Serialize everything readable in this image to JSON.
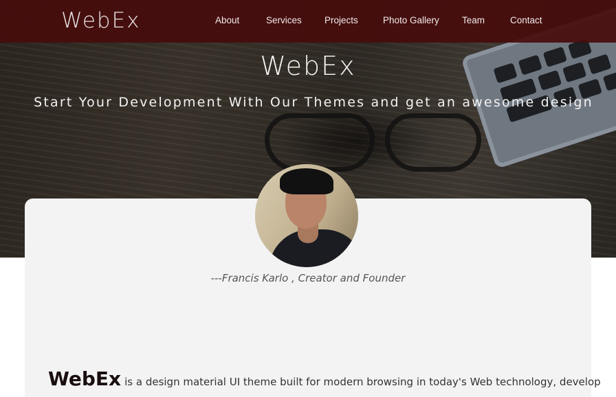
{
  "navbar": {
    "brand": "WebEx",
    "links": [
      {
        "label": "About"
      },
      {
        "label": "Services"
      },
      {
        "label": "Projects"
      },
      {
        "label": "Photo Gallery"
      },
      {
        "label": "Team"
      },
      {
        "label": "Contact"
      }
    ]
  },
  "hero": {
    "title": "WebEx",
    "subtitle": "Start Your Development With Our Themes and get an awesome design"
  },
  "founder": {
    "quote": "---Francis Karlo , Creator and Founder"
  },
  "about": {
    "brand": "WebEx",
    "text": "is a design material UI theme built for modern browsing in today's Web technology, develop"
  },
  "colors": {
    "navbar_bg": "#460c0c",
    "card_bg": "#f3f3f3",
    "text_dark": "#1a0f0f"
  }
}
